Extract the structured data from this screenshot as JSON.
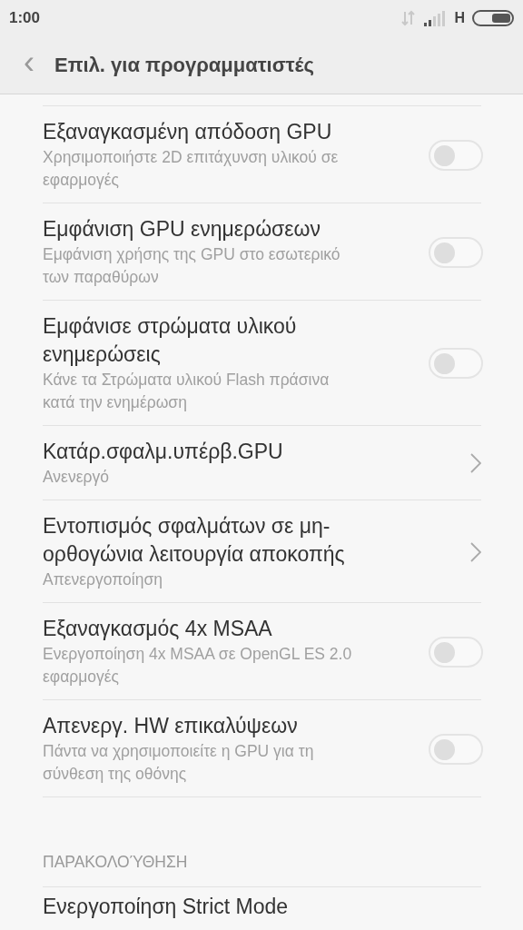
{
  "status_bar": {
    "time": "1:00",
    "network_type": "H"
  },
  "header": {
    "back": "‹",
    "title": "Επιλ. για προγραμματιστές"
  },
  "items": [
    {
      "kind": "toggle",
      "title": "Εξαναγκασμένη απόδοση GPU",
      "subtitle": "Χρησιμοποιήστε 2D επιτάχυνση υλικού σε εφαρμογές",
      "on": false
    },
    {
      "kind": "toggle",
      "title": "Εμφάνιση GPU ενημερώσεων",
      "subtitle": "Εμφάνιση χρήσης της GPU στο εσωτερικό των παραθύρων",
      "on": false
    },
    {
      "kind": "toggle",
      "title": "Εμφάνισε στρώματα υλικού ενημερώσεις",
      "subtitle": "Κάνε τα Στρώματα υλικού Flash πράσινα κατά την ενημέρωση",
      "on": false
    },
    {
      "kind": "link",
      "title": "Κατάρ.σφαλμ.υπέρβ.GPU",
      "subtitle": "Ανενεργό"
    },
    {
      "kind": "link",
      "title": "Εντοπισμός σφαλμάτων σε μη-ορθογώνια λειτουργία αποκοπής",
      "subtitle": "Απενεργοποίηση"
    },
    {
      "kind": "toggle",
      "title": "Εξαναγκασμός 4x MSAA",
      "subtitle": "Ενεργοποίηση 4x MSAA σε OpenGL ES 2.0 εφαρμογές",
      "on": false
    },
    {
      "kind": "toggle",
      "title": "Απενεργ. HW επικαλύψεων",
      "subtitle": "Πάντα να χρησιμοποιείτε η GPU για τη σύνθεση της οθόνης",
      "on": false
    }
  ],
  "section": {
    "title": "ΠΑΡΑΚΟΛΟΎΘΗΣΗ",
    "items": [
      {
        "title": "Ενεργοποίηση Strict Mode"
      }
    ]
  }
}
